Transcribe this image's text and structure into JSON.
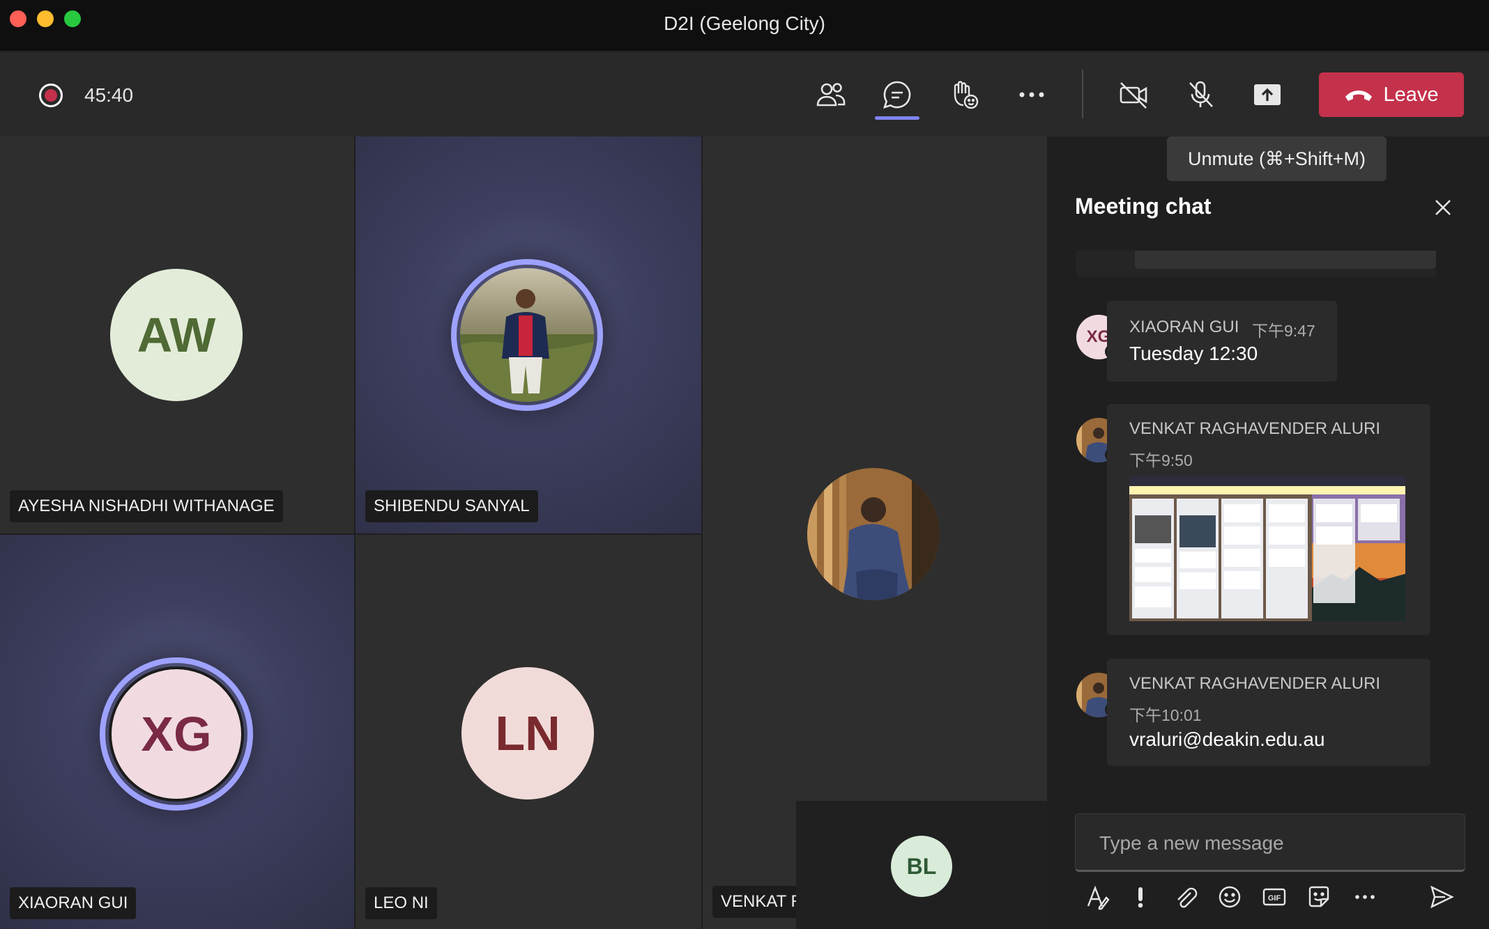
{
  "window": {
    "title": "D2I (Geelong City)"
  },
  "toolbar": {
    "timer": "45:40",
    "leave_label": "Leave",
    "tooltip": "Unmute (⌘+Shift+M)"
  },
  "participants": [
    {
      "name": "AYESHA NISHADHI WITHANAGE",
      "initials": "AW"
    },
    {
      "name": "SHIBENDU SANYAL",
      "initials": ""
    },
    {
      "name": "VENKAT R",
      "initials": ""
    },
    {
      "name": "XIAORAN GUI",
      "initials": "XG"
    },
    {
      "name": "LEO NI",
      "initials": "LN"
    },
    {
      "name": "",
      "initials": "BL"
    }
  ],
  "chat": {
    "title": "Meeting chat",
    "messages": [
      {
        "author": "XIAORAN GUI",
        "avatar_initials": "XG",
        "time": "下午9:47",
        "text": "Tuesday 12:30"
      },
      {
        "author": "VENKAT RAGHAVENDER ALURI",
        "time": "下午9:50",
        "text": ""
      },
      {
        "author": "VENKAT RAGHAVENDER ALURI",
        "time": "下午10:01",
        "text": "vraluri@deakin.edu.au"
      }
    ],
    "compose_placeholder": "Type a new message"
  },
  "colors": {
    "leave": "#c4314b",
    "accent": "#7f85f5",
    "ring": "#9ea2ff",
    "busy": "#c4314b"
  }
}
